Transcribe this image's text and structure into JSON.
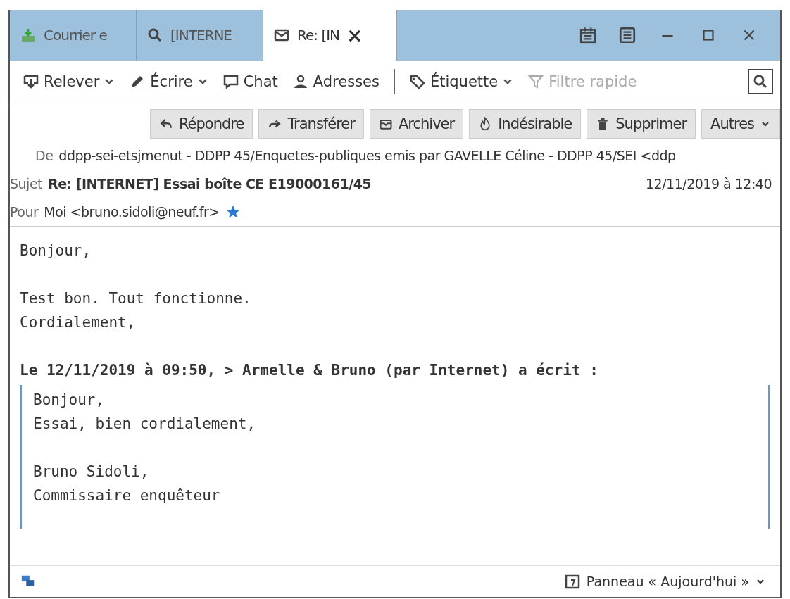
{
  "tabs": [
    {
      "label": "Courrier e",
      "selected": false
    },
    {
      "label": "[INTERNE",
      "selected": false
    },
    {
      "label": "Re: [IN",
      "selected": true,
      "close": "×"
    }
  ],
  "toolbar": [
    {
      "label": "Relever",
      "dropdown": true,
      "disabled": false
    },
    {
      "label": "Écrire",
      "dropdown": true,
      "disabled": false
    },
    {
      "label": "Chat",
      "dropdown": false,
      "disabled": false
    },
    {
      "label": "Adresses",
      "dropdown": false,
      "disabled": false
    },
    {
      "label": "Étiquette",
      "dropdown": true,
      "disabled": false
    },
    {
      "label": "Filtre rapide",
      "dropdown": false,
      "disabled": true
    }
  ],
  "actions": [
    {
      "label": "Répondre"
    },
    {
      "label": "Transférer"
    },
    {
      "label": "Archiver"
    },
    {
      "label": "Indésirable"
    },
    {
      "label": "Supprimer"
    },
    {
      "label": "Autres"
    }
  ],
  "header": {
    "from_label": "De",
    "from": "ddpp-sei-etsjmenut - DDPP 45/Enquetes-publiques emis par GAVELLE Céline - DDPP 45/SEI <ddp",
    "subject_label": "Sujet",
    "subject": "Re: [INTERNET] Essai boîte CE E19000161/45",
    "date": "12/11/2019 à 12:40",
    "to_label": "Pour",
    "to": "Moi <bruno.sidoli@neuf.fr>"
  },
  "body": {
    "paragraphs": [
      [
        "Bonjour,"
      ],
      [
        "Test bon. Tout fonctionne.",
        "Cordialement,"
      ]
    ],
    "quote_header": "Le 12/11/2019 à 09:50, > Armelle & Bruno (par Internet) a écrit :",
    "quote": [
      [
        "Bonjour,",
        "Essai, bien cordialement,"
      ],
      [
        "Bruno Sidoli,",
        "Commissaire enquêteur"
      ]
    ]
  },
  "status_bar": {
    "today_pane": "Panneau « Aujourd'hui »"
  }
}
